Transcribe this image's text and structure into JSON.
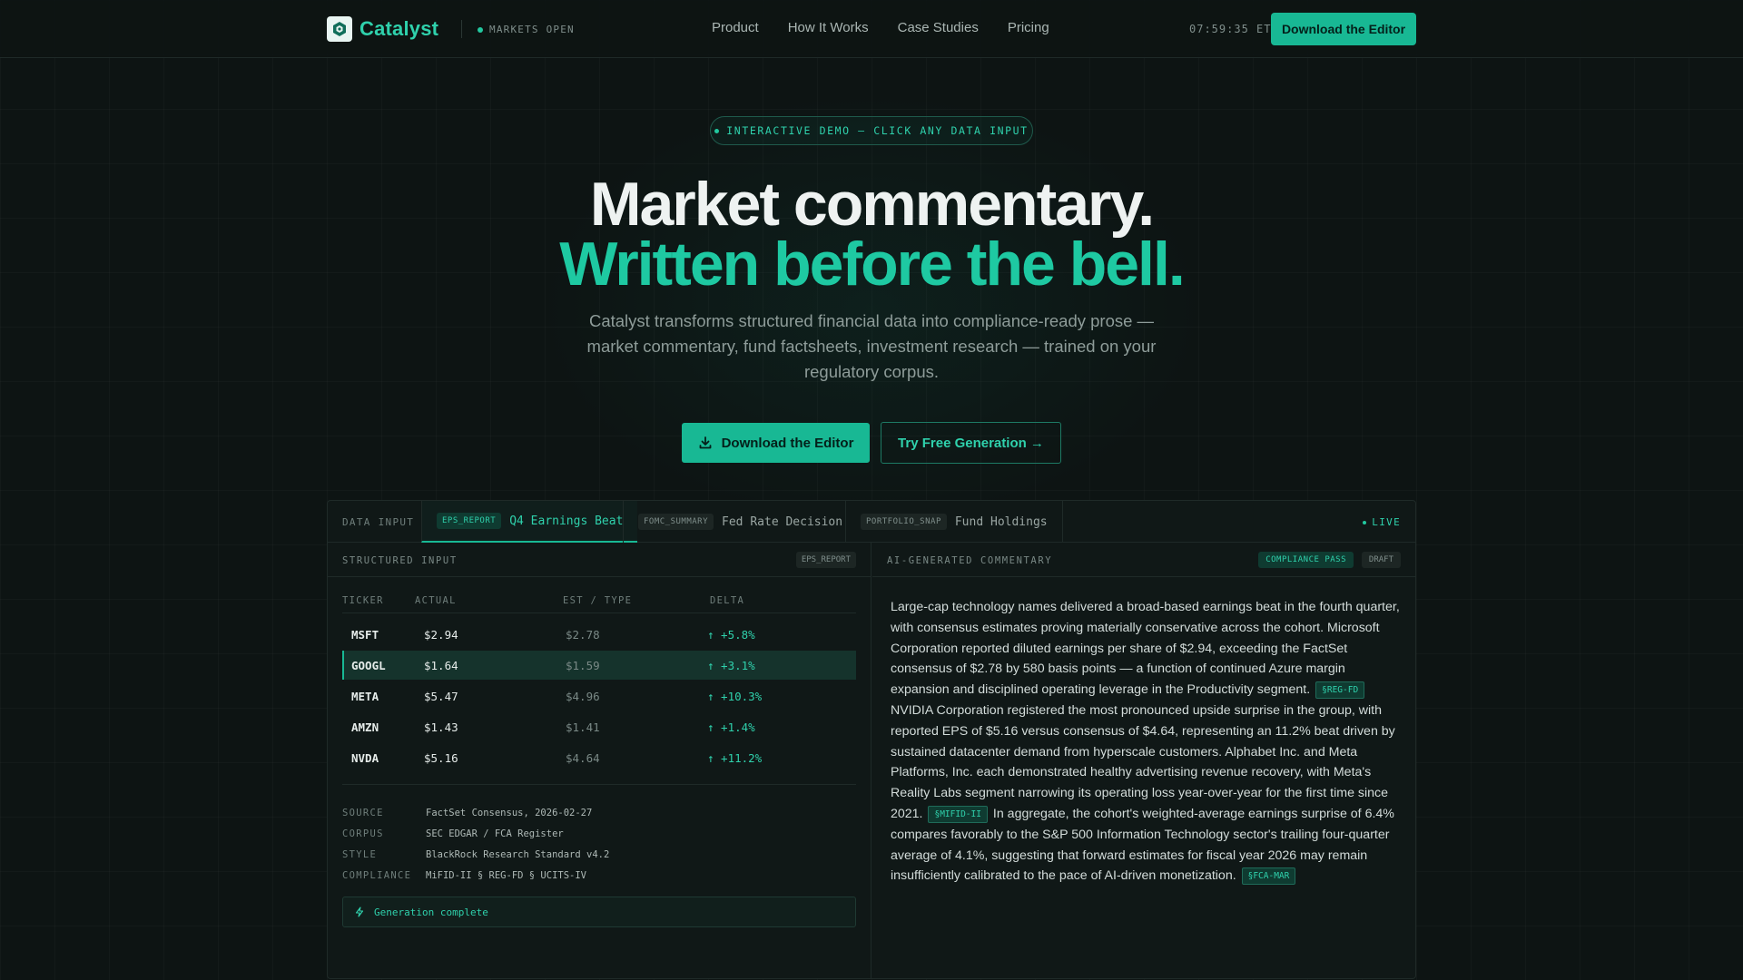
{
  "nav": {
    "brand": "Catalyst",
    "market_status": "MARKETS OPEN",
    "links": [
      "Product",
      "How It Works",
      "Case Studies",
      "Pricing"
    ],
    "clock": "07:59:35 ET",
    "cta": "Download the Editor"
  },
  "hero": {
    "pill": "INTERACTIVE DEMO — CLICK ANY DATA INPUT",
    "title_line1": "Market commentary.",
    "title_line2": "Written before the bell.",
    "subtitle": "Catalyst transforms structured financial data into compliance-ready prose — market commentary, fund factsheets, investment research — trained on your regulatory corpus.",
    "primary_cta": "Download the Editor",
    "secondary_cta": "Try Free Generation →"
  },
  "demo": {
    "tab_label": "DATA INPUT",
    "tabs": [
      {
        "tag": "EPS_REPORT",
        "label": "Q4 Earnings Beat"
      },
      {
        "tag": "FOMC_SUMMARY",
        "label": "Fed Rate Decision"
      },
      {
        "tag": "PORTFOLIO_SNAP",
        "label": "Fund Holdings"
      }
    ],
    "live": "LIVE",
    "input": {
      "title": "STRUCTURED INPUT",
      "tag": "EPS_REPORT",
      "columns": [
        "TICKER",
        "ACTUAL",
        "EST / TYPE",
        "DELTA"
      ],
      "rows": [
        {
          "ticker": "MSFT",
          "actual": "$2.94",
          "est": "$2.78",
          "delta": "↑ +5.8%"
        },
        {
          "ticker": "GOOGL",
          "actual": "$1.64",
          "est": "$1.59",
          "delta": "↑ +3.1%"
        },
        {
          "ticker": "META",
          "actual": "$5.47",
          "est": "$4.96",
          "delta": "↑ +10.3%"
        },
        {
          "ticker": "AMZN",
          "actual": "$1.43",
          "est": "$1.41",
          "delta": "↑ +1.4%"
        },
        {
          "ticker": "NVDA",
          "actual": "$5.16",
          "est": "$4.64",
          "delta": "↑ +11.2%"
        }
      ],
      "meta": [
        {
          "key": "SOURCE",
          "value": "FactSet Consensus, 2026-02-27"
        },
        {
          "key": "CORPUS",
          "value": "SEC EDGAR / FCA Register"
        },
        {
          "key": "STYLE",
          "value": "BlackRock Research Standard v4.2"
        },
        {
          "key": "COMPLIANCE",
          "value": "MiFID-II § REG-FD § UCITS-IV"
        }
      ],
      "status": "Generation complete"
    },
    "output": {
      "title": "AI-GENERATED COMMENTARY",
      "badge_pass": "COMPLIANCE PASS",
      "badge_draft": "DRAFT",
      "p1": "Large-cap technology names delivered a broad-based earnings beat in the fourth quarter, with consensus estimates proving materially conservative across the cohort. Microsoft Corporation reported diluted earnings per share of $2.94, exceeding the FactSet consensus of $2.78 by 580 basis points — a function of continued Azure margin expansion and disciplined operating leverage in the Productivity segment.",
      "cite1": "§REG-FD",
      "p2": "NVIDIA Corporation registered the most pronounced upside surprise in the group, with reported EPS of $5.16 versus consensus of $4.64, representing an 11.2% beat driven by sustained datacenter demand from hyperscale customers. Alphabet Inc. and Meta Platforms, Inc. each demonstrated healthy advertising revenue recovery, with Meta's Reality Labs segment narrowing its operating loss year-over-year for the first time since 2021.",
      "cite2": "§MIFID-II",
      "p3": "In aggregate, the cohort's weighted-average earnings surprise of 6.4% compares favorably to the S&P 500 Information Technology sector's trailing four-quarter average of 4.1%, suggesting that forward estimates for fiscal year 2026 may remain insufficiently calibrated to the pace of AI-driven monetization.",
      "cite3": "§FCA-MAR"
    }
  }
}
